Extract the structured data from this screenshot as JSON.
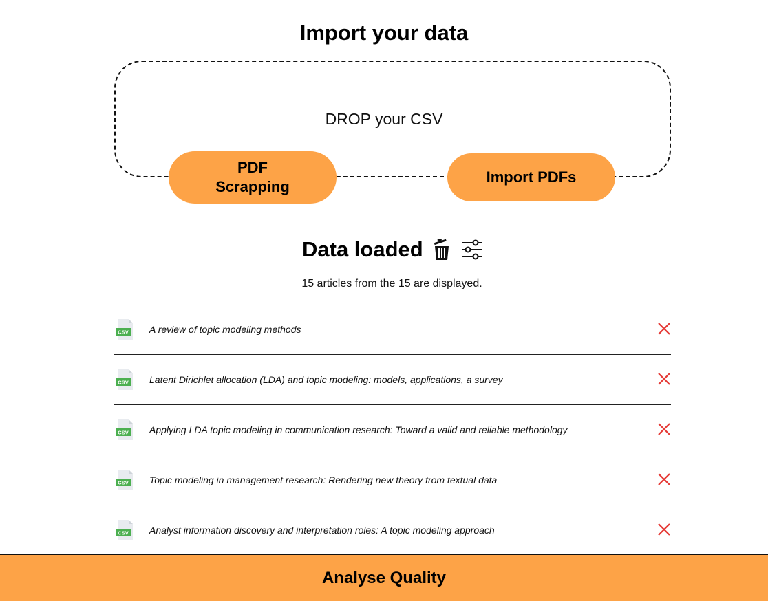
{
  "import": {
    "title": "Import your data",
    "drop_text": "DROP your CSV",
    "pdf_scrapping_label": "PDF\nScrapping",
    "import_pdfs_label": "Import PDFs"
  },
  "data_loaded": {
    "title": "Data loaded",
    "delete_all_icon": "trash-icon",
    "filter_icon": "sliders-icon",
    "summary": "15 articles from the 15 are displayed."
  },
  "articles": [
    {
      "title": "A review of topic modeling methods",
      "file_type": "CSV"
    },
    {
      "title": "Latent Dirichlet allocation (LDA) and topic modeling: models, applications, a survey",
      "file_type": "CSV"
    },
    {
      "title": "Applying LDA topic modeling in communication research: Toward a valid and reliable methodology",
      "file_type": "CSV"
    },
    {
      "title": "Topic modeling in management research: Rendering new theory from textual data",
      "file_type": "CSV"
    },
    {
      "title": "Analyst information discovery and interpretation roles: A topic modeling approach",
      "file_type": "CSV"
    }
  ],
  "footer": {
    "analyse_label": "Analyse Quality"
  },
  "colors": {
    "accent": "#fda347",
    "remove": "#e53935",
    "csv_badge": "#4caf50"
  }
}
